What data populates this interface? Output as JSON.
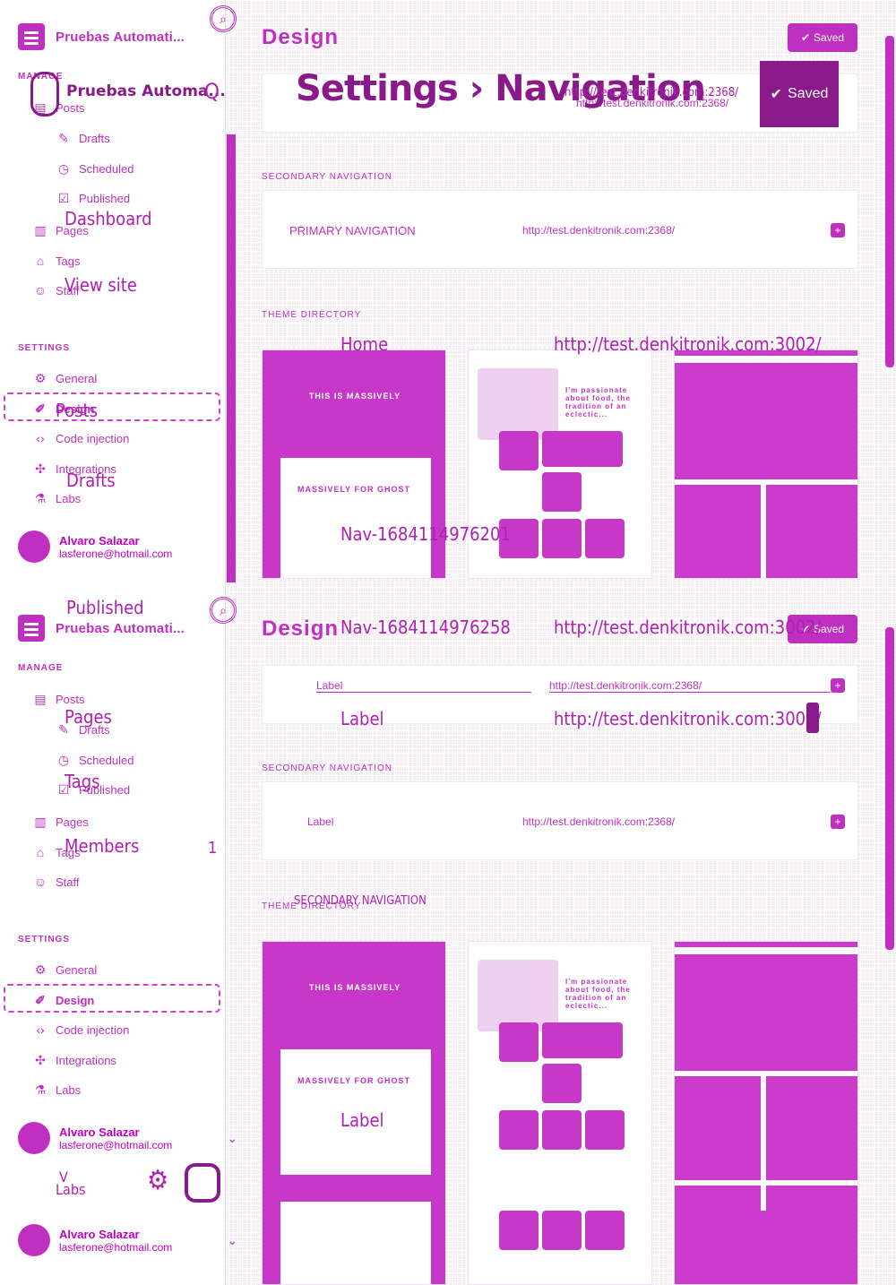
{
  "app": {
    "brand": "Pruebas Automati...",
    "brand_full": "Pruebas Automa...",
    "page_title": "Design",
    "saved_label": "Saved",
    "breadcrumb": "Settings › Navigation"
  },
  "sidebar": {
    "manage_label": "MANAGE",
    "settings_label": "SETTINGS",
    "manage_items": [
      {
        "label": "Posts",
        "icon": "posts-icon"
      },
      {
        "label": "Drafts",
        "icon": "pencil-icon"
      },
      {
        "label": "Scheduled",
        "icon": "clock-icon"
      },
      {
        "label": "Published",
        "icon": "check-doc-icon"
      },
      {
        "label": "Pages",
        "icon": "pages-icon"
      },
      {
        "label": "Tags",
        "icon": "tag-icon"
      },
      {
        "label": "Staff",
        "icon": "staff-icon"
      }
    ],
    "settings_items": [
      {
        "label": "General",
        "icon": "gear-icon"
      },
      {
        "label": "Design",
        "icon": "brush-icon"
      },
      {
        "label": "Code injection",
        "icon": "code-icon"
      },
      {
        "label": "Integrations",
        "icon": "integrations-icon"
      },
      {
        "label": "Labs",
        "icon": "flask-icon"
      }
    ],
    "user_name": "Alvaro Salazar",
    "user_email": "lasferone@hotmail.com"
  },
  "content": {
    "site_url": "http://test.denkitronik.com:2368/",
    "secondary_nav_caption": "SECONDARY NAVIGATION",
    "theme_caption": "THEME DIRECTORY",
    "label_placeholder": "Label",
    "primary_nav": "PRIMARY NAVIGATION",
    "secondary_nav": "SECONDARY NAVIGATION"
  },
  "overlay": {
    "dashboard": "Dashboard",
    "view_site": "View site",
    "posts": "Posts",
    "drafts": "Drafts",
    "published": "Published",
    "pages": "Pages",
    "tags": "Tags",
    "members": "Members",
    "members_count": "1",
    "home": "Home",
    "home_url": "http://test.denkitronik.com:3002/",
    "nav_id_1": "Nav-1684114976201",
    "nav_id_2": "Nav-1684114976258",
    "label": "Label",
    "lab": "Labs",
    "v_label": "V"
  },
  "theme_thumbs": {
    "a_title": "THIS IS MASSIVELY",
    "a_sub": "MASSIVELY FOR GHOST",
    "b_text": "I'm passionate about food, the tradition of an eclectic..."
  },
  "colors": {
    "accent": "#c030c0",
    "grid": "#f4f0f4"
  }
}
